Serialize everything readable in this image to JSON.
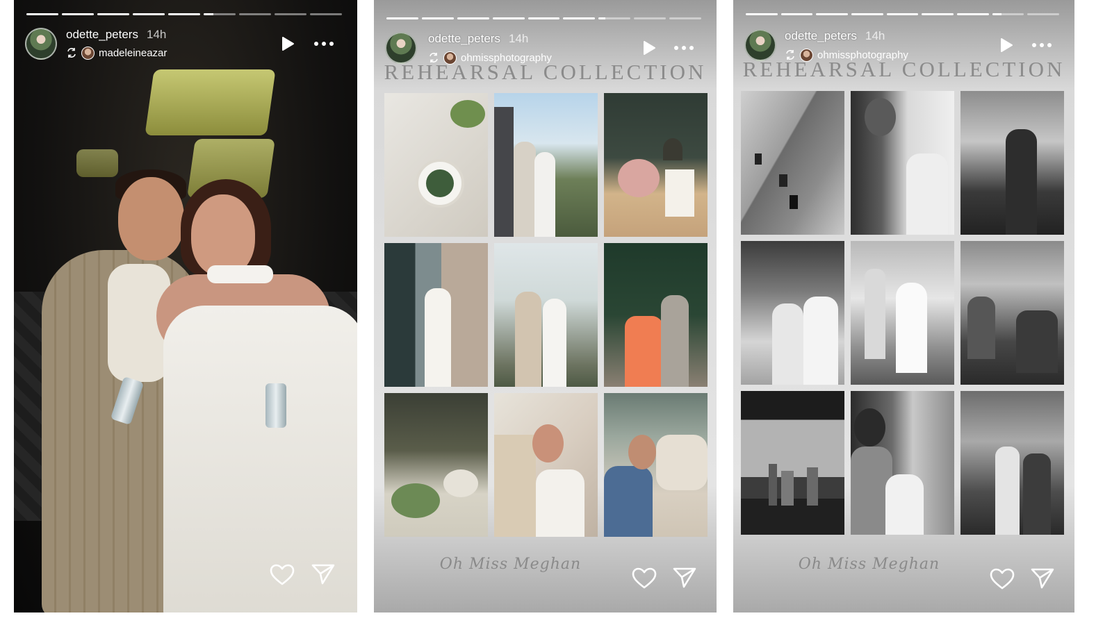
{
  "stories": [
    {
      "username": "odette_peters",
      "timestamp": "14h",
      "reposted_from": "madeleineazar",
      "progress": {
        "segments": 9,
        "completed": 5,
        "current_fraction": 0.3
      }
    },
    {
      "username": "odette_peters",
      "timestamp": "14h",
      "reposted_from": "ohmissphotography",
      "title": "REHEARSAL COLLECTION",
      "signature": "Oh Miss Meghan",
      "progress": {
        "segments": 9,
        "completed": 6,
        "current_fraction": 0.2
      }
    },
    {
      "username": "odette_peters",
      "timestamp": "14h",
      "reposted_from": "ohmissphotography",
      "title": "REHEARSAL COLLECTION",
      "signature": "Oh Miss Meghan",
      "progress": {
        "segments": 9,
        "completed": 7,
        "current_fraction": 0.3
      }
    }
  ],
  "icons": {
    "play": "play-icon",
    "more": "more-icon",
    "repost": "repost-icon",
    "like": "heart-icon",
    "share": "send-icon"
  },
  "colors": {
    "overlay_text": "#ffffff",
    "title_gray": "#8b8b8b"
  }
}
